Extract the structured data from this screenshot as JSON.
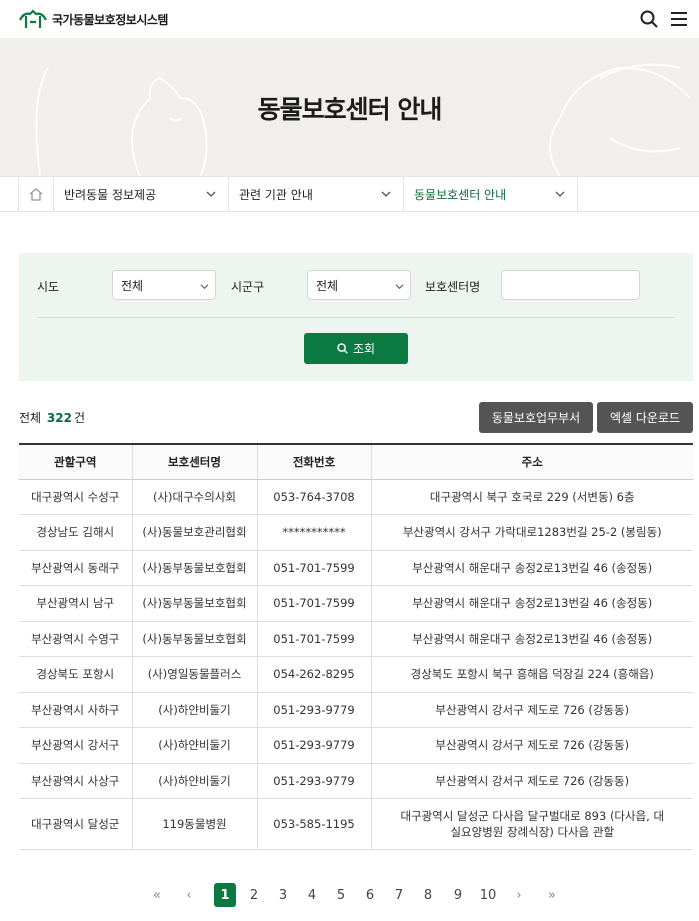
{
  "header": {
    "site_title": "국가동물보호정보시스템"
  },
  "hero": {
    "title": "동물보호센터 안내"
  },
  "breadcrumb": {
    "items": [
      {
        "label": "반려동물 정보제공"
      },
      {
        "label": "관련 기관 안내"
      },
      {
        "label": "동물보호센터 안내"
      }
    ]
  },
  "filter": {
    "sido_label": "시도",
    "sido_value": "전체",
    "sigungu_label": "시군구",
    "sigungu_value": "전체",
    "center_label": "보호센터명",
    "center_value": "",
    "search_label": "조회"
  },
  "summary": {
    "prefix": "전체",
    "count": "322",
    "suffix": "건",
    "btn_dept": "동물보호업무부서",
    "btn_excel": "엑셀 다운로드"
  },
  "table": {
    "headers": [
      "관할구역",
      "보호센터명",
      "전화번호",
      "주소"
    ],
    "rows": [
      [
        "대구광역시 수성구",
        "(사)대구수의사회",
        "053-764-3708",
        "대구광역시 북구 호국로 229 (서변동) 6층"
      ],
      [
        "경상남도 김해시",
        "(사)동물보호관리협회",
        "***********",
        "부산광역시 강서구 가락대로1283번길 25-2 (봉림동)"
      ],
      [
        "부산광역시 동래구",
        "(사)동부동물보호협회",
        "051-701-7599",
        "부산광역시 해운대구 송정2로13번길 46 (송정동)"
      ],
      [
        "부산광역시 남구",
        "(사)동부동물보호협회",
        "051-701-7599",
        "부산광역시 해운대구 송정2로13번길 46 (송정동)"
      ],
      [
        "부산광역시 수영구",
        "(사)동부동물보호협회",
        "051-701-7599",
        "부산광역시 해운대구 송정2로13번길 46 (송정동)"
      ],
      [
        "경상북도 포항시",
        "(사)영일동물플러스",
        "054-262-8295",
        "경상북도 포항시 북구 흥해읍 덕장길 224 (흥해읍)"
      ],
      [
        "부산광역시 사하구",
        "(사)하얀비둘기",
        "051-293-9779",
        "부산광역시 강서구 제도로 726 (강동동)"
      ],
      [
        "부산광역시 강서구",
        "(사)하얀비둘기",
        "051-293-9779",
        "부산광역시 강서구 제도로 726 (강동동)"
      ],
      [
        "부산광역시 사상구",
        "(사)하얀비둘기",
        "051-293-9779",
        "부산광역시 강서구 제도로 726 (강동동)"
      ],
      [
        "대구광역시 달성군",
        "119동물병원",
        "053-585-1195",
        "대구광역시 달성군 다사읍 달구벌대로 893 (다사읍, 대실요양병원 장례식장) 다사읍 관할"
      ]
    ]
  },
  "pagination": {
    "first": "«",
    "prev": "‹",
    "pages": [
      "1",
      "2",
      "3",
      "4",
      "5",
      "6",
      "7",
      "8",
      "9",
      "10"
    ],
    "current": "1",
    "next": "›",
    "last": "»"
  },
  "colors": {
    "brand_green": "#0a7a40",
    "filter_bg": "#edf5f0",
    "hero_bg": "#f1efeb"
  }
}
